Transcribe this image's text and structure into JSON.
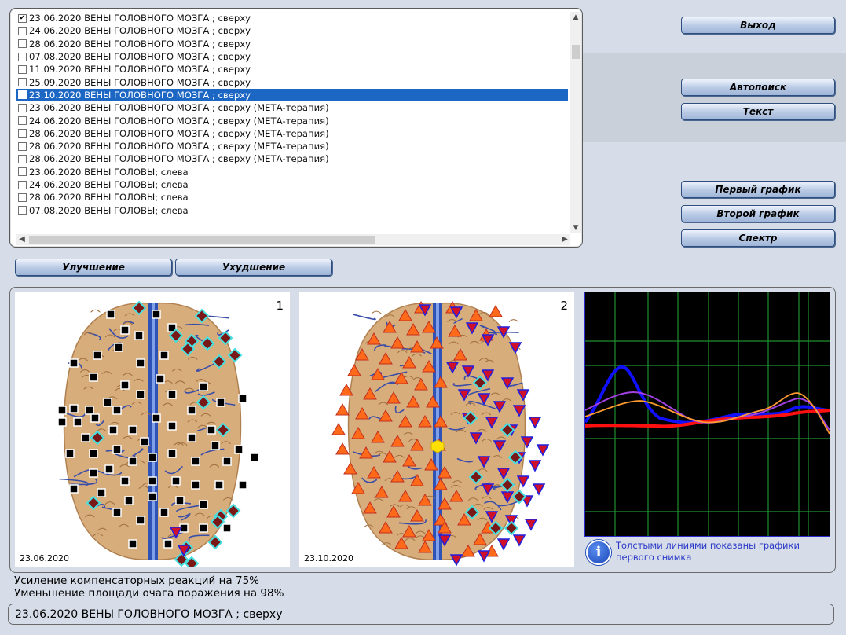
{
  "list": {
    "items": [
      {
        "checked": true,
        "text": "23.06.2020  ВЕНЫ  ГОЛОВНОГО МОЗГА ; сверху"
      },
      {
        "checked": false,
        "text": "24.06.2020  ВЕНЫ  ГОЛОВНОГО МОЗГА ; сверху"
      },
      {
        "checked": false,
        "text": "28.06.2020  ВЕНЫ  ГОЛОВНОГО МОЗГА ; сверху"
      },
      {
        "checked": false,
        "text": "07.08.2020  ВЕНЫ  ГОЛОВНОГО МОЗГА ; сверху"
      },
      {
        "checked": false,
        "text": "11.09.2020  ВЕНЫ  ГОЛОВНОГО МОЗГА ; сверху"
      },
      {
        "checked": false,
        "text": "25.09.2020  ВЕНЫ  ГОЛОВНОГО МОЗГА ; сверху"
      },
      {
        "checked": false,
        "selected": true,
        "text": "23.10.2020  ВЕНЫ  ГОЛОВНОГО МОЗГА ; сверху"
      },
      {
        "checked": false,
        "text": "23.06.2020  ВЕНЫ  ГОЛОВНОГО МОЗГА ; сверху  (МЕТА-терапия)"
      },
      {
        "checked": false,
        "text": "24.06.2020  ВЕНЫ  ГОЛОВНОГО МОЗГА ; сверху  (МЕТА-терапия)"
      },
      {
        "checked": false,
        "text": "28.06.2020  ВЕНЫ  ГОЛОВНОГО МОЗГА ; сверху  (МЕТА-терапия)"
      },
      {
        "checked": false,
        "text": "28.06.2020  ВЕНЫ  ГОЛОВНОГО МОЗГА ; сверху  (МЕТА-терапия)"
      },
      {
        "checked": false,
        "text": "28.06.2020  ВЕНЫ  ГОЛОВНОГО МОЗГА ; сверху  (МЕТА-терапия)"
      },
      {
        "checked": false,
        "text": "23.06.2020  ВЕНЫ  ГОЛОВЫ;  слева"
      },
      {
        "checked": false,
        "text": "24.06.2020  ВЕНЫ  ГОЛОВЫ;  слева"
      },
      {
        "checked": false,
        "text": "28.06.2020  ВЕНЫ  ГОЛОВЫ;  слева"
      },
      {
        "checked": false,
        "text": "07.08.2020  ВЕНЫ  ГОЛОВЫ;  слева"
      }
    ]
  },
  "buttons": {
    "exit": "Выход",
    "autosearch": "Автопоиск",
    "text": "Текст",
    "first_graph": "Первый график",
    "second_graph": "Второй график",
    "spectrum": "Спектр",
    "improvement": "Улучшение",
    "deterioration": "Ухудшение"
  },
  "images": {
    "first": {
      "number": "1",
      "date": "23.06.2020"
    },
    "second": {
      "number": "2",
      "date": "23.10.2020"
    }
  },
  "graph": {
    "info_text": "Толстыми линиями показаны графики первого снимка",
    "colors": {
      "blue": "#1010ff",
      "red": "#ff1010",
      "purple": "#a040e0",
      "orange": "#ff9a30",
      "grid": "#1f8f2f"
    }
  },
  "results": {
    "line1": "Усиление компенсаторных реакций на 75%",
    "line2": "Уменьшение площади очага поражения на 98%"
  },
  "status": "23.06.2020 ВЕНЫ  ГОЛОВНОГО МОЗГА ; сверху",
  "icons": {
    "checkbox_checked": "✔",
    "scroll_up": "▲",
    "scroll_down": "▼",
    "scroll_left": "◀",
    "scroll_right": "▶",
    "info": "i"
  }
}
